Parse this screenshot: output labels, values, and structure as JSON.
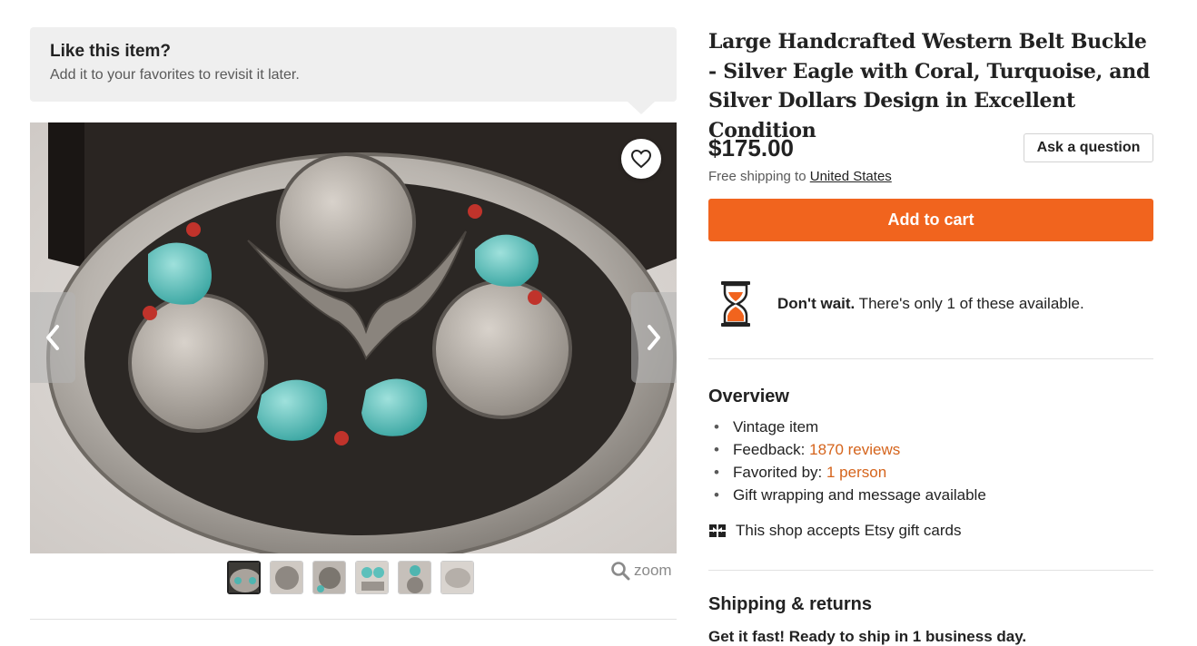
{
  "favorites_banner": {
    "title": "Like this item?",
    "subtitle": "Add it to your favorites to revisit it later."
  },
  "gallery": {
    "image_description": "oval silver belt buckle with eagle, coins, turquoise and coral stones",
    "icons": {
      "favorite": "heart-icon",
      "prev": "chevron-left-icon",
      "next": "chevron-right-icon",
      "zoom": "magnifier-icon"
    },
    "thumbnail_count": 6,
    "active_thumbnail": 1,
    "zoom_label": "zoom"
  },
  "listing": {
    "title": "Large Handcrafted Western Belt Buckle - Silver Eagle with Coral, Turquoise, and Silver Dollars Design in Excellent Condition",
    "price": "$175.00",
    "ask_question_label": "Ask a question",
    "shipping_prefix": "Free shipping to ",
    "shipping_destination": "United States",
    "add_to_cart_label": "Add to cart",
    "scarcity_bold": "Don't wait.",
    "scarcity_rest": " There's only 1 of these available."
  },
  "overview": {
    "heading": "Overview",
    "vintage": "Vintage item",
    "feedback_prefix": "Feedback: ",
    "feedback_link": "1870 reviews",
    "favorited_prefix": "Favorited by: ",
    "favorited_link": "1 person",
    "gift_wrap": "Gift wrapping and message available",
    "gift_cards": "This shop accepts Etsy gift cards"
  },
  "shipping_returns": {
    "heading": "Shipping & returns",
    "ready": "Get it fast! Ready to ship in 1 business day."
  },
  "colors": {
    "accent_orange": "#f1641e",
    "link_orange": "#d5641c",
    "hourglass_orange": "#f1641e"
  }
}
